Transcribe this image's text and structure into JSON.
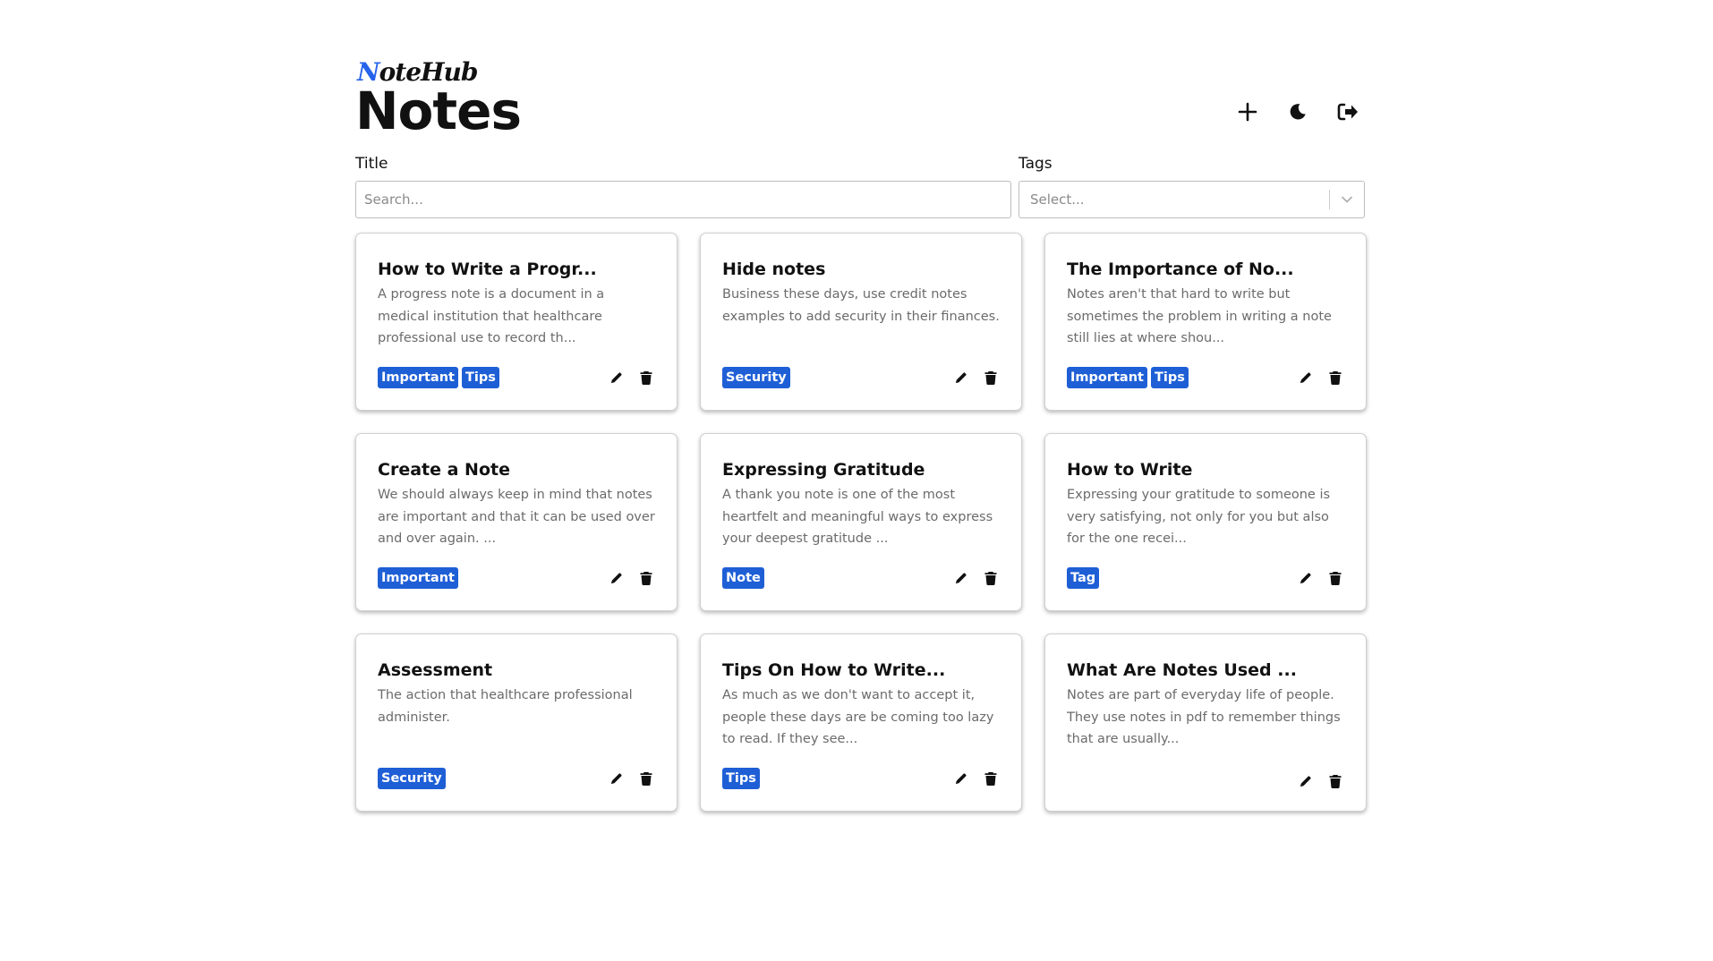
{
  "brand": {
    "logo_first": "N",
    "logo_rest": "oteHub",
    "logo_color": "#2563eb"
  },
  "header": {
    "title": "Notes",
    "actions": [
      {
        "icon": "plus-icon"
      },
      {
        "icon": "moon-icon"
      },
      {
        "icon": "logout-icon"
      }
    ]
  },
  "filters": {
    "title_label": "Title",
    "title_placeholder": "Search...",
    "tags_label": "Tags",
    "tags_placeholder": "Select..."
  },
  "colors": {
    "tag_bg": "#1f5fd6",
    "tag_text": "#ffffff"
  },
  "notes": [
    {
      "title": "How to Write a Progr...",
      "body": "A progress note is a document in a medical institution that healthcare professional use to record th...",
      "tags": [
        "Important",
        "Tips"
      ]
    },
    {
      "title": "Hide notes",
      "body": "Business these days, use credit notes examples to add security in their finances.",
      "tags": [
        "Security"
      ]
    },
    {
      "title": "The Importance of No...",
      "body": "Notes aren't that hard to write but sometimes the problem in writing a note still lies at where shou...",
      "tags": [
        "Important",
        "Tips"
      ]
    },
    {
      "title": "Create a Note",
      "body": "We should always keep in mind that notes are important and that it can be used over and over again. ...",
      "tags": [
        "Important"
      ]
    },
    {
      "title": "Expressing Gratitude",
      "body": "A thank you note is one of the most heartfelt and meaningful ways to express your deepest gratitude ...",
      "tags": [
        "Note"
      ]
    },
    {
      "title": "How to Write",
      "body": "Expressing your gratitude to someone is very satisfying, not only for you but also for the one recei...",
      "tags": [
        "Tag"
      ]
    },
    {
      "title": "Assessment",
      "body": "The action that healthcare professional administer.",
      "tags": [
        "Security"
      ]
    },
    {
      "title": "Tips On How to Write...",
      "body": "As much as we don't want to accept it, people these days are be coming too lazy to read. If they see...",
      "tags": [
        "Tips"
      ]
    },
    {
      "title": "What Are Notes Used ...",
      "body": "Notes are part of everyday life of people. They use notes in pdf to remember things that are usually...",
      "tags": []
    }
  ]
}
